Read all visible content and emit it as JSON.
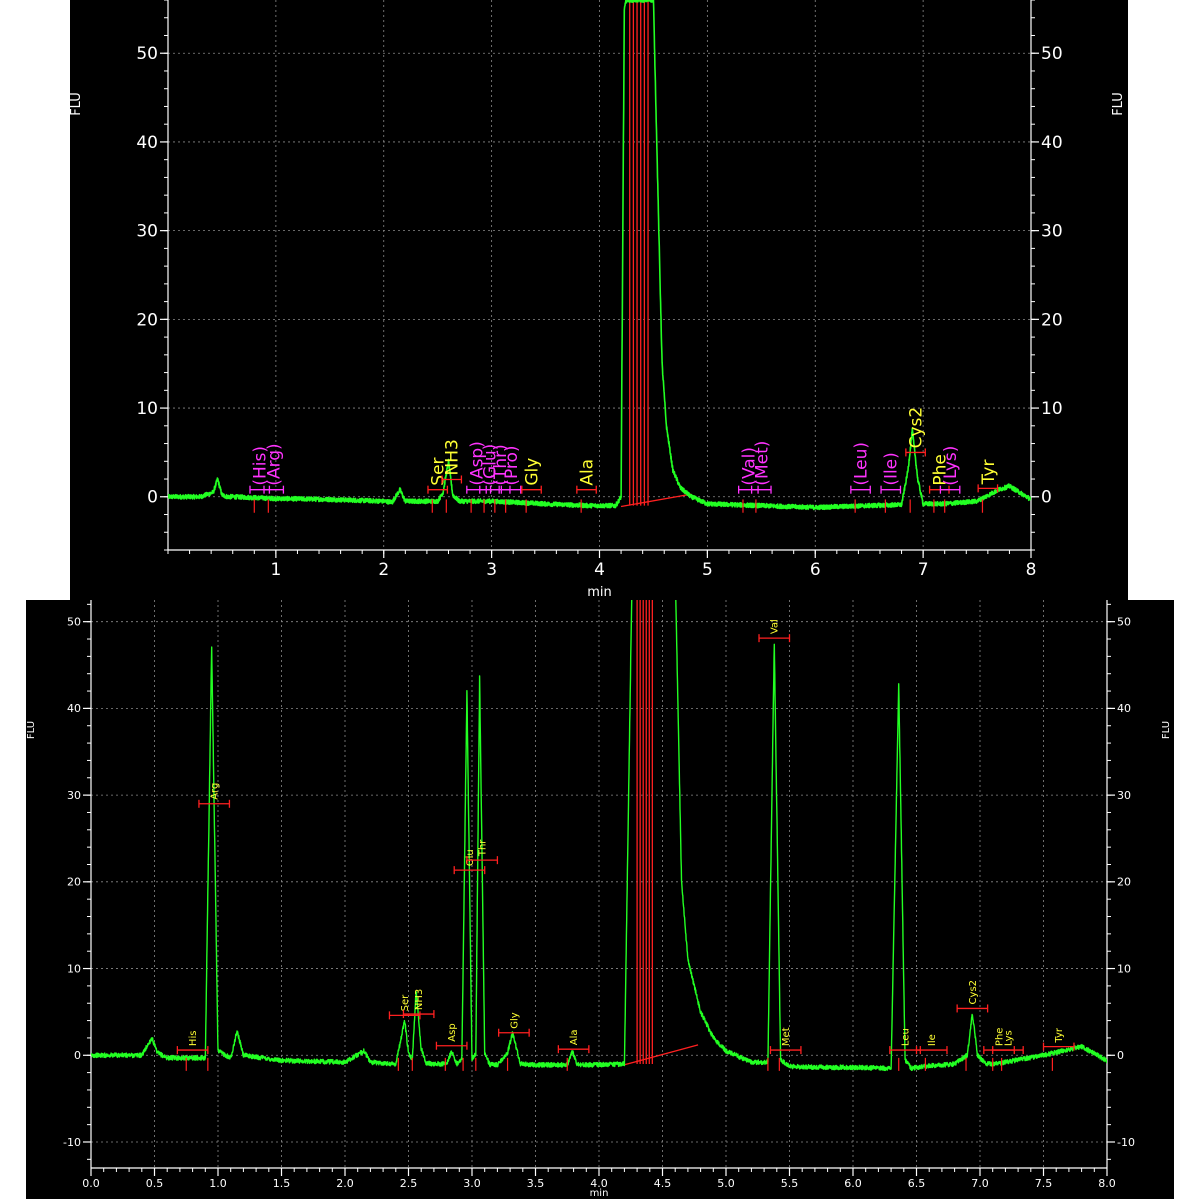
{
  "chart_data": [
    {
      "type": "line",
      "title": "",
      "xlabel": "min",
      "ylabel": "FLU",
      "xlim": [
        0,
        8
      ],
      "ylim": [
        -6,
        56
      ],
      "xticks": [
        1,
        2,
        3,
        4,
        5,
        6,
        7,
        8
      ],
      "xtick_labels": [
        "1",
        "2",
        "3",
        "4",
        "5",
        "6",
        "7",
        "8"
      ],
      "yticks": [
        0,
        10,
        20,
        30,
        40,
        50
      ],
      "ytick_labels": [
        "0",
        "10",
        "20",
        "30",
        "40",
        "50"
      ],
      "grid": true,
      "background": "#000000",
      "trace_color": "#22ff22",
      "baseline_color": "#ff2020",
      "peak_label_color": "#ffff33",
      "unidentified_label_color": "#ff33ff",
      "series": [
        {
          "color": "#22ff22",
          "x": [
            0.0,
            0.3,
            0.42,
            0.46,
            0.5,
            0.55,
            0.6,
            1.0,
            1.5,
            2.0,
            2.08,
            2.15,
            2.2,
            2.5,
            2.55,
            2.6,
            2.64,
            2.7,
            3.0,
            3.5,
            3.9,
            4.15,
            4.2,
            4.23,
            4.25,
            4.3,
            4.5,
            4.55,
            4.58,
            4.62,
            4.68,
            4.75,
            4.85,
            5.0,
            5.5,
            6.0,
            6.5,
            6.8,
            6.86,
            6.9,
            6.95,
            7.0,
            7.2,
            7.5,
            7.7,
            7.8,
            8.0
          ],
          "y": [
            0.0,
            0.0,
            0.5,
            2.0,
            0.2,
            0.0,
            0.0,
            -0.2,
            -0.3,
            -0.5,
            -0.6,
            0.8,
            -0.5,
            -0.5,
            0.5,
            4.0,
            0.2,
            -0.5,
            -0.5,
            -0.8,
            -1.0,
            -1.0,
            0.0,
            55,
            56,
            56,
            56,
            30,
            15,
            8,
            3,
            1.0,
            0.0,
            -0.8,
            -1.0,
            -1.2,
            -1.0,
            -0.9,
            3.0,
            7.5,
            2.0,
            -0.8,
            -0.8,
            -0.5,
            0.8,
            1.2,
            -0.3
          ]
        }
      ],
      "peaks": [
        {
          "name": "(His)",
          "rt": 0.85,
          "kind": "unidentified"
        },
        {
          "name": "(Arg)",
          "rt": 0.98,
          "kind": "unidentified"
        },
        {
          "name": "Ser",
          "rt": 2.5,
          "kind": "identified"
        },
        {
          "name": "NH3",
          "rt": 2.63,
          "kind": "identified"
        },
        {
          "name": "(Asp)",
          "rt": 2.86,
          "kind": "unidentified"
        },
        {
          "name": "(Glu)",
          "rt": 2.98,
          "kind": "unidentified"
        },
        {
          "name": "(Thr)",
          "rt": 3.08,
          "kind": "unidentified"
        },
        {
          "name": "(Pro)",
          "rt": 3.18,
          "kind": "unidentified"
        },
        {
          "name": "Gly",
          "rt": 3.37,
          "kind": "identified"
        },
        {
          "name": "Ala",
          "rt": 3.88,
          "kind": "identified"
        },
        {
          "name": "(Val)",
          "rt": 5.38,
          "kind": "unidentified"
        },
        {
          "name": "(Met)",
          "rt": 5.5,
          "kind": "unidentified"
        },
        {
          "name": "(Leu)",
          "rt": 6.42,
          "kind": "unidentified"
        },
        {
          "name": "(Ile)",
          "rt": 6.7,
          "kind": "unidentified"
        },
        {
          "name": "Cys2",
          "rt": 6.93,
          "kind": "identified"
        },
        {
          "name": "Phe",
          "rt": 7.15,
          "kind": "identified"
        },
        {
          "name": "(Lys)",
          "rt": 7.25,
          "kind": "unidentified"
        },
        {
          "name": "Tyr",
          "rt": 7.6,
          "kind": "identified"
        }
      ]
    },
    {
      "type": "line",
      "title": "",
      "xlabel": "min",
      "ylabel": "FLU",
      "xlim": [
        0,
        8
      ],
      "ylim": [
        -13,
        52.5
      ],
      "xticks": [
        0.0,
        0.5,
        1.0,
        1.5,
        2.0,
        2.5,
        3.0,
        3.5,
        4.0,
        4.5,
        5.0,
        5.5,
        6.0,
        6.5,
        7.0,
        7.5,
        8.0
      ],
      "xtick_labels": [
        "0.0",
        "0.5",
        "1.0",
        "1.5",
        "2.0",
        "2.5",
        "3.0",
        "3.5",
        "4.0",
        "4.5",
        "5.0",
        "5.5",
        "6.0",
        "6.5",
        "7.0",
        "7.5",
        "8.0"
      ],
      "yticks": [
        -10,
        0,
        10,
        20,
        30,
        40,
        50
      ],
      "ytick_labels": [
        "-10",
        "0",
        "10",
        "20",
        "30",
        "40",
        "50"
      ],
      "grid": true,
      "background": "#000000",
      "trace_color": "#22ff22",
      "baseline_color": "#ff2020",
      "peak_label_color": "#ffff33",
      "series": [
        {
          "color": "#22ff22",
          "x": [
            0.0,
            0.4,
            0.48,
            0.52,
            0.6,
            0.9,
            0.95,
            1.0,
            1.1,
            1.15,
            1.2,
            1.5,
            2.0,
            2.15,
            2.2,
            2.4,
            2.47,
            2.5,
            2.53,
            2.56,
            2.6,
            2.64,
            2.7,
            2.8,
            2.84,
            2.88,
            2.92,
            2.96,
            3.0,
            3.03,
            3.06,
            3.1,
            3.14,
            3.2,
            3.28,
            3.32,
            3.38,
            3.5,
            3.75,
            3.79,
            3.83,
            4.0,
            4.2,
            4.26,
            4.3,
            4.6,
            4.65,
            4.7,
            4.8,
            4.9,
            5.0,
            5.2,
            5.33,
            5.38,
            5.43,
            5.5,
            5.8,
            6.0,
            6.3,
            6.36,
            6.41,
            6.46,
            6.55,
            6.8,
            6.9,
            6.94,
            6.98,
            7.05,
            7.1,
            7.2,
            7.5,
            7.8,
            8.0
          ],
          "y": [
            0.0,
            0.0,
            2.0,
            0.3,
            -0.3,
            -0.3,
            47.0,
            0.5,
            -0.3,
            2.8,
            0.0,
            -0.6,
            -0.8,
            0.5,
            -0.8,
            -1.0,
            4.0,
            0.2,
            -0.5,
            7.5,
            0.8,
            -0.9,
            -1.0,
            -1.0,
            0.5,
            -1.0,
            -0.5,
            42.0,
            -0.5,
            0.2,
            43.5,
            0.3,
            -1.1,
            -1.1,
            0.3,
            2.6,
            -1.0,
            -1.1,
            -1.1,
            0.5,
            -1.1,
            -1.1,
            -1.0,
            55,
            56,
            56,
            20,
            11,
            5,
            2.0,
            0.5,
            -0.8,
            -0.8,
            47.5,
            -0.5,
            -1.3,
            -1.4,
            -1.4,
            -1.5,
            42.8,
            -0.5,
            -1.5,
            -1.3,
            -1.0,
            0.0,
            4.8,
            0.0,
            -1.0,
            -1.0,
            -0.8,
            0.0,
            1.0,
            -0.6
          ]
        }
      ],
      "peaks": [
        {
          "name": "His",
          "rt": 0.8,
          "kind": "identified"
        },
        {
          "name": "Arg",
          "rt": 0.97,
          "kind": "identified"
        },
        {
          "name": "Ser",
          "rt": 2.47,
          "kind": "identified"
        },
        {
          "name": "NH3",
          "rt": 2.58,
          "kind": "identified"
        },
        {
          "name": "Asp",
          "rt": 2.84,
          "kind": "identified"
        },
        {
          "name": "Glu",
          "rt": 2.98,
          "kind": "identified"
        },
        {
          "name": "Thr",
          "rt": 3.08,
          "kind": "identified"
        },
        {
          "name": "Gly",
          "rt": 3.33,
          "kind": "identified"
        },
        {
          "name": "Ala",
          "rt": 3.8,
          "kind": "identified"
        },
        {
          "name": "Val",
          "rt": 5.38,
          "kind": "identified"
        },
        {
          "name": "Met",
          "rt": 5.47,
          "kind": "identified"
        },
        {
          "name": "Leu",
          "rt": 6.41,
          "kind": "identified"
        },
        {
          "name": "Ile",
          "rt": 6.62,
          "kind": "identified"
        },
        {
          "name": "Cys2",
          "rt": 6.94,
          "kind": "identified"
        },
        {
          "name": "Phe",
          "rt": 7.15,
          "kind": "identified"
        },
        {
          "name": "Lys",
          "rt": 7.22,
          "kind": "identified"
        },
        {
          "name": "Tyr",
          "rt": 7.62,
          "kind": "identified"
        }
      ]
    }
  ]
}
